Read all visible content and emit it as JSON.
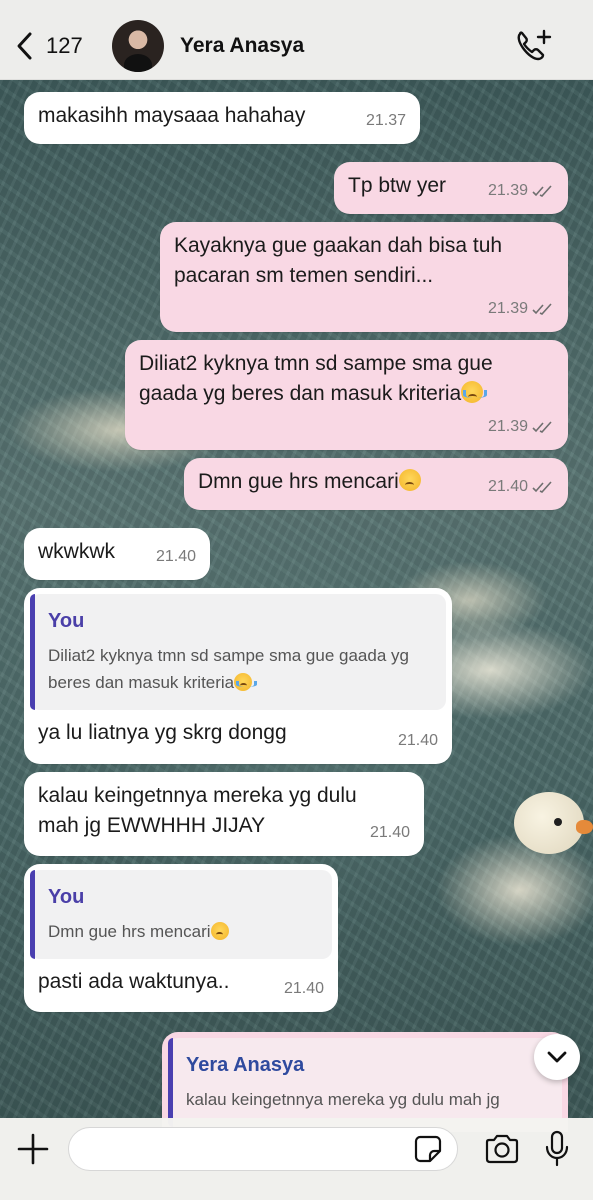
{
  "header": {
    "back_count": "127",
    "contact_name": "Yera Anasya",
    "back_icon": "chevron-left-icon",
    "call_icon": "add-call-icon"
  },
  "messages": [
    {
      "dir": "in",
      "text": "makasihh maysaaa hahahay",
      "time": "21.37"
    },
    {
      "dir": "out",
      "text": "Tp btw yer",
      "time": "21.39",
      "status": "read"
    },
    {
      "dir": "out",
      "text": "Kayaknya gue gaakan dah bisa tuh pacaran sm temen sendiri...",
      "time": "21.39",
      "status": "read"
    },
    {
      "dir": "out",
      "text": "Diliat2 kyknya tmn sd sampe sma gue gaada yg beres dan masuk kriteria",
      "emoji": "loudly-crying-face",
      "time": "21.39",
      "status": "read"
    },
    {
      "dir": "out",
      "text": "Dmn gue hrs mencari",
      "emoji": "crying-face",
      "time": "21.40",
      "status": "read"
    },
    {
      "dir": "in",
      "text": "wkwkwk",
      "time": "21.40"
    },
    {
      "dir": "in",
      "quote_author": "You",
      "quote_text": "Diliat2 kyknya tmn sd sampe sma gue gaada yg beres dan masuk kriteria",
      "text": "ya lu liatnya yg skrg dongg",
      "time": "21.40"
    },
    {
      "dir": "in",
      "text": "kalau keingetnnya mereka yg dulu mah jg EWWHHH JIJAY",
      "time": "21.40"
    },
    {
      "dir": "in",
      "quote_author": "You",
      "quote_text": "Dmn gue hrs mencari",
      "text": "pasti ada waktunya..",
      "time": "21.40"
    },
    {
      "dir": "out",
      "quote_author": "Yera Anasya",
      "quote_text": "kalau keingetnnya mereka yg dulu mah jg"
    }
  ],
  "input": {
    "placeholder": "",
    "icons": [
      "plus-icon",
      "sticker-icon",
      "camera-icon",
      "microphone-icon"
    ]
  },
  "colors": {
    "outgoing_bubble": "#f9d8e4",
    "incoming_bubble": "#ffffff",
    "quote_bar": "#4a3fb0"
  }
}
